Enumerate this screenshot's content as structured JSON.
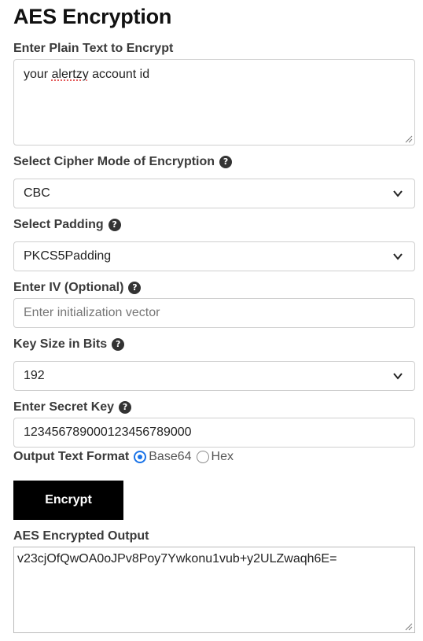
{
  "title": "AES Encryption",
  "plaintext": {
    "label": "Enter Plain Text to Encrypt",
    "value_prefix": "your ",
    "value_misspelled": "alertzy",
    "value_suffix": " account id"
  },
  "cipher_mode": {
    "label": "Select Cipher Mode of Encryption",
    "selected": "CBC"
  },
  "padding": {
    "label": "Select Padding",
    "selected": "PKCS5Padding"
  },
  "iv": {
    "label": "Enter IV (Optional)",
    "placeholder": "Enter initialization vector"
  },
  "key_size": {
    "label": "Key Size in Bits",
    "selected": "192"
  },
  "secret_key": {
    "label": "Enter Secret Key",
    "value": "123456789000123456789000"
  },
  "output_format": {
    "label": "Output Text Format",
    "options": [
      "Base64",
      "Hex"
    ],
    "selected": "Base64"
  },
  "encrypt_button": "Encrypt",
  "output": {
    "label": "AES Encrypted Output",
    "value": "v23cjOfQwOA0oJPv8Poy7Ywkonu1vub+y2ULZwaqh6E="
  },
  "colors": {
    "radio_accent": "#1a73e8",
    "button_bg": "#000000",
    "button_text": "#ffffff"
  },
  "icons": {
    "help": "question-circle-icon",
    "dropdown": "chevron-down-icon"
  }
}
